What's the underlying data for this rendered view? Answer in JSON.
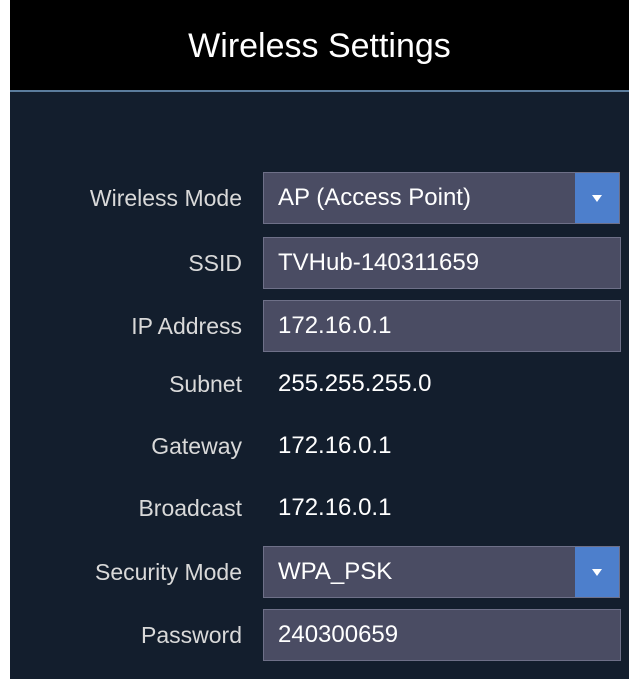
{
  "window": {
    "title": "Wireless Settings"
  },
  "fields": {
    "wireless_mode": {
      "label": "Wireless Mode",
      "value": "AP (Access Point)"
    },
    "ssid": {
      "label": "SSID",
      "value": "TVHub-140311659"
    },
    "ip_address": {
      "label": "IP Address",
      "value": "172.16.0.1"
    },
    "subnet": {
      "label": "Subnet",
      "value": "255.255.255.0"
    },
    "gateway": {
      "label": "Gateway",
      "value": "172.16.0.1"
    },
    "broadcast": {
      "label": "Broadcast",
      "value": "172.16.0.1"
    },
    "security_mode": {
      "label": "Security Mode",
      "value": "WPA_PSK"
    },
    "password": {
      "label": "Password",
      "value": "240300659"
    }
  },
  "icons": {
    "dropdown": "chevron-down-icon"
  },
  "colors": {
    "background": "#131e2d",
    "titlebar": "#000000",
    "field_bg": "#4a4c63",
    "accent": "#4d7fcc",
    "label_text": "#d9d9d9",
    "value_text": "#ffffff"
  }
}
